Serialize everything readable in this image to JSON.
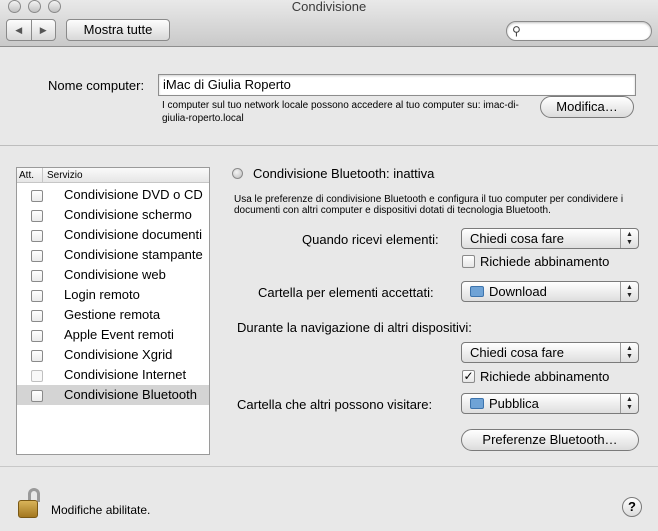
{
  "window": {
    "title": "Condivisione"
  },
  "toolbar": {
    "back_label": "◀",
    "forward_label": "▶",
    "show_all_label": "Mostra tutte",
    "search_placeholder": "",
    "search_icon": "search-icon"
  },
  "computer": {
    "name_label": "Nome computer:",
    "name_value": "iMac di Giulia Roperto",
    "note": "I computer sul tuo network locale possono accedere al tuo computer su: imac-di-giulia-roperto.local",
    "edit_button": "Modifica…"
  },
  "services": {
    "col_on": "Att.",
    "col_service": "Servizio",
    "items": [
      {
        "label": "Condivisione DVD o CD",
        "checked": false
      },
      {
        "label": "Condivisione schermo",
        "checked": false
      },
      {
        "label": "Condivisione documenti",
        "checked": false
      },
      {
        "label": "Condivisione stampante",
        "checked": false
      },
      {
        "label": "Condivisione web",
        "checked": false
      },
      {
        "label": "Login remoto",
        "checked": false
      },
      {
        "label": "Gestione remota",
        "checked": false
      },
      {
        "label": "Apple Event remoti",
        "checked": false
      },
      {
        "label": "Condivisione Xgrid",
        "checked": false
      },
      {
        "label": "Condivisione Internet",
        "checked": false,
        "disabled": true
      },
      {
        "label": "Condivisione Bluetooth",
        "checked": false,
        "selected": true
      }
    ]
  },
  "bluetooth": {
    "status": "Condivisione Bluetooth: inattiva",
    "description": "Usa le preferenze di condivisione Bluetooth e configura il tuo computer per condividere i documenti con altri computer e dispositivi dotati di tecnologia Bluetooth.",
    "receive_label": "Quando ricevi elementi:",
    "receive_value": "Chiedi cosa fare",
    "receive_pair_label": "Richiede abbinamento",
    "receive_pair_checked": false,
    "accepted_folder_label": "Cartella per elementi accettati:",
    "accepted_folder_value": "Download",
    "browsing_label": "Durante la navigazione di altri dispositivi:",
    "browsing_value": "Chiedi cosa fare",
    "browsing_pair_label": "Richiede abbinamento",
    "browsing_pair_checked": true,
    "visit_folder_label": "Cartella che altri possono visitare:",
    "visit_folder_value": "Pubblica",
    "prefs_button": "Preferenze Bluetooth…"
  },
  "footer": {
    "lock_text": "Modifiche abilitate.",
    "help_label": "?"
  }
}
